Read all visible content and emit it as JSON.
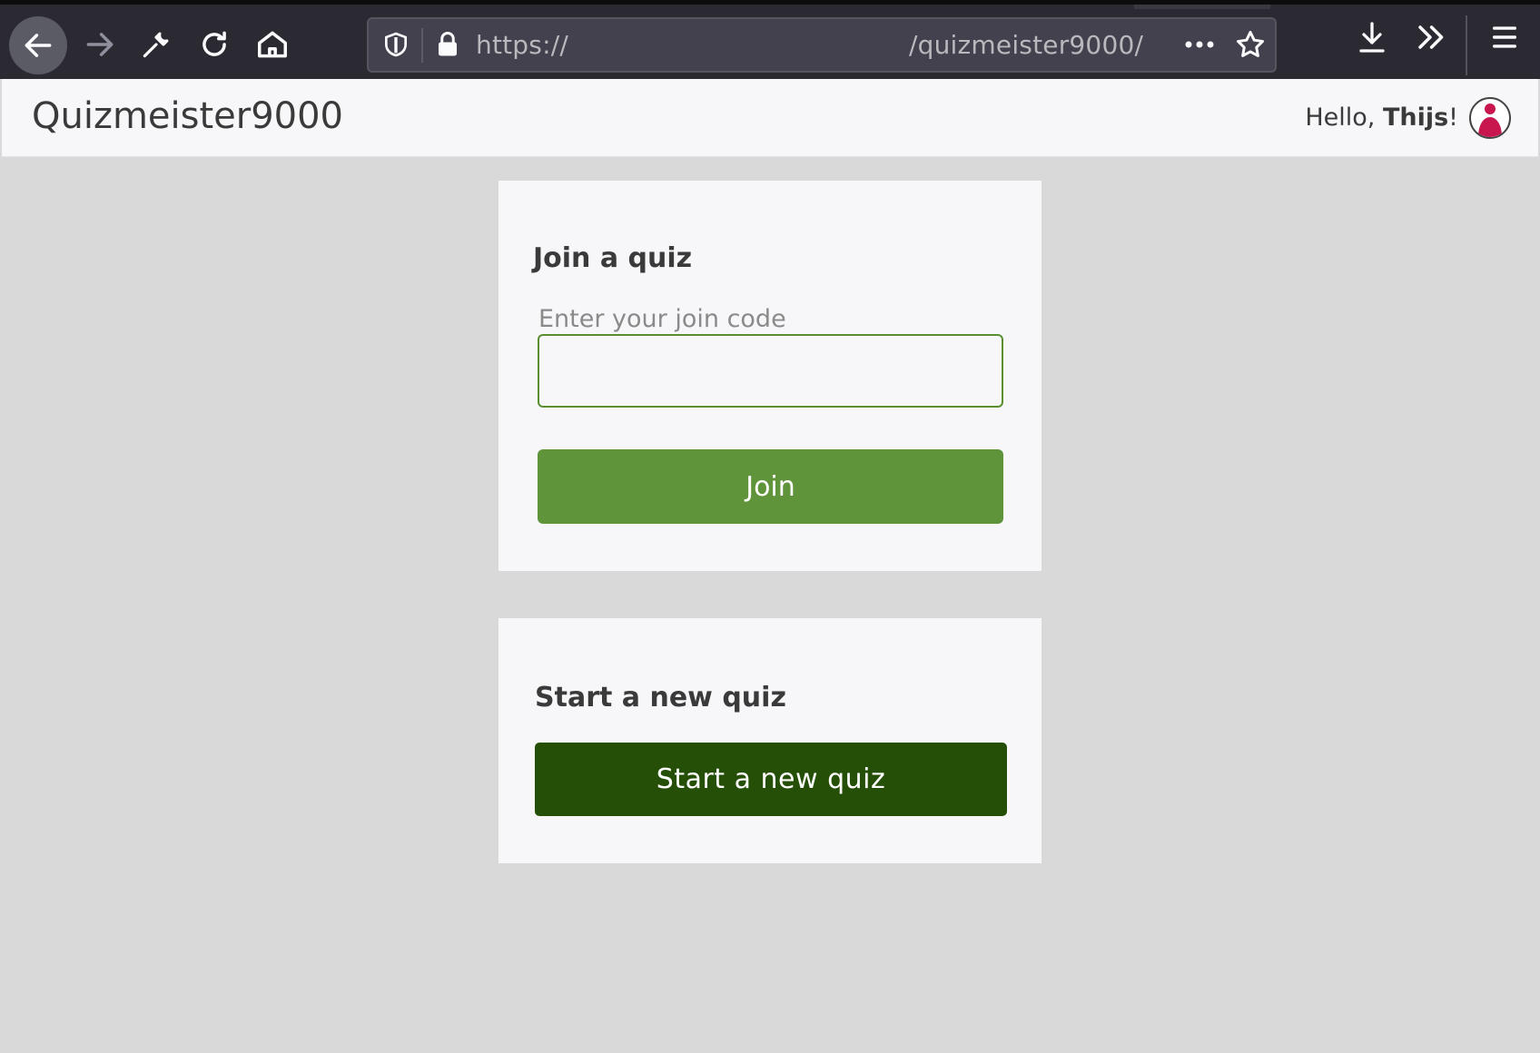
{
  "browser": {
    "url_scheme": "https://",
    "url_path": "/quizmeister9000/",
    "icons": [
      "back-arrow-icon",
      "forward-arrow-icon",
      "wrench-icon",
      "reload-icon",
      "home-icon",
      "shield-icon",
      "lock-icon",
      "more-dots-icon",
      "star-icon",
      "download-icon",
      "overflow-chevrons-icon",
      "hamburger-menu-icon"
    ]
  },
  "header": {
    "brand": "Quizmeister9000",
    "greeting_prefix": "Hello, ",
    "user_name": "Thijs",
    "greeting_suffix": "!",
    "avatar_color": "#c8174f"
  },
  "join_card": {
    "title": "Join a quiz",
    "field_label": "Enter your join code",
    "input_value": "",
    "button_label": "Join",
    "button_color": "#5f943a"
  },
  "start_card": {
    "title": "Start a new quiz",
    "button_label": "Start a new quiz",
    "button_color": "#254f07"
  }
}
